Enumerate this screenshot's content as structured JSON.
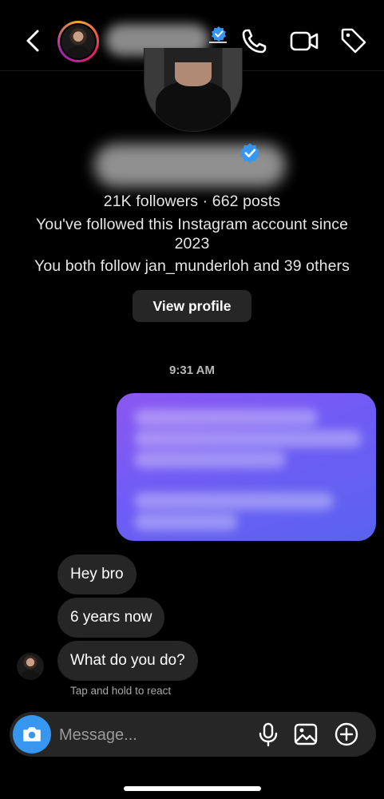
{
  "header": {
    "back_icon": "chevron-left-icon",
    "actions": [
      "phone-icon",
      "video-camera-icon",
      "tag-icon"
    ],
    "verified_color": "#3797f0"
  },
  "profile": {
    "stats": "21K followers · 662 posts",
    "since_line1": "You've followed this Instagram account since",
    "since_line2": "2023",
    "mutual": "You both follow jan_munderloh and 39 others",
    "view_profile_label": "View profile"
  },
  "thread": {
    "timestamp": "9:31 AM",
    "sent_bubble_gradient": [
      "#8c57f2",
      "#5a63f0"
    ],
    "received": [
      "Hey bro",
      "6 years now",
      "What do you do?"
    ],
    "hint": "Tap and hold to react"
  },
  "composer": {
    "placeholder": "Message...",
    "camera_color": "#3797f0",
    "icons": [
      "microphone-icon",
      "gallery-icon",
      "plus-circle-icon"
    ]
  }
}
